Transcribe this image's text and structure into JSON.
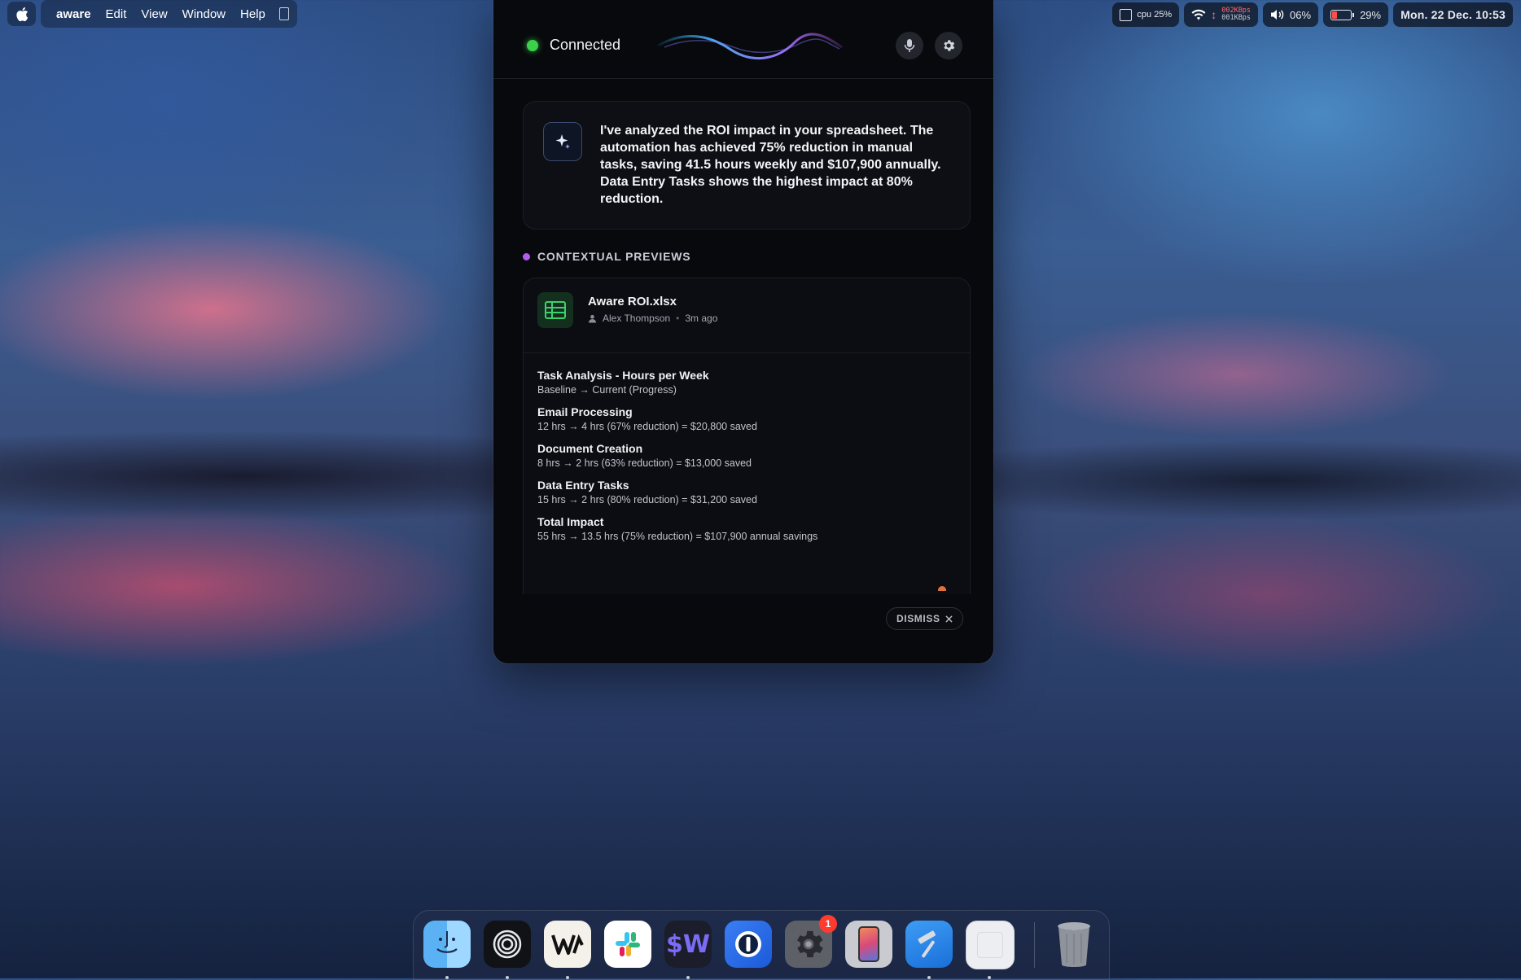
{
  "menubar": {
    "app_name": "aware",
    "items": [
      "Edit",
      "View",
      "Window",
      "Help"
    ],
    "cpu": "cpu 25%",
    "net_up": "002KBps",
    "net_down": "001KBps",
    "volume": "06%",
    "battery": "29%",
    "datetime": "Mon. 22 Dec. 10:53"
  },
  "panel": {
    "status": "Connected",
    "status_color": "#3bd14a",
    "message": "I've analyzed the ROI impact in your spreadsheet. The automation has achieved 75% reduction in manual tasks, saving 41.5 hours weekly and $107,900 annually. Data Entry Tasks shows the highest impact at 80% reduction.",
    "section_title": "CONTEXTUAL PREVIEWS",
    "file": {
      "name": "Aware ROI.xlsx",
      "author": "Alex Thompson",
      "time": "3m ago",
      "icon": "spreadsheet-icon"
    },
    "blocks": [
      {
        "title": "Task Analysis - Hours per Week",
        "sub": "Baseline → Current (Progress)"
      },
      {
        "title": "Email Processing",
        "sub": "12 hrs → 4 hrs (67% reduction) = $20,800 saved"
      },
      {
        "title": "Document Creation",
        "sub": "8 hrs → 2 hrs (63% reduction) = $13,000 saved"
      },
      {
        "title": "Data Entry Tasks",
        "sub": "15 hrs → 2 hrs (80% reduction) = $31,200 saved"
      },
      {
        "title": "Total Impact",
        "sub": "55 hrs → 13.5 hrs (75% reduction) = $107,900 annual savings"
      }
    ],
    "dismiss_label": "DISMISS"
  },
  "dock": {
    "apps": [
      "finder-icon",
      "spiral-app-icon",
      "writer-app-icon",
      "slack-icon",
      "sw-app-icon",
      "1password-icon",
      "system-settings-icon",
      "iphone-mirroring-icon",
      "xcode-icon",
      "blank-app-icon"
    ],
    "settings_badge": "1",
    "trash": "trash-icon"
  }
}
